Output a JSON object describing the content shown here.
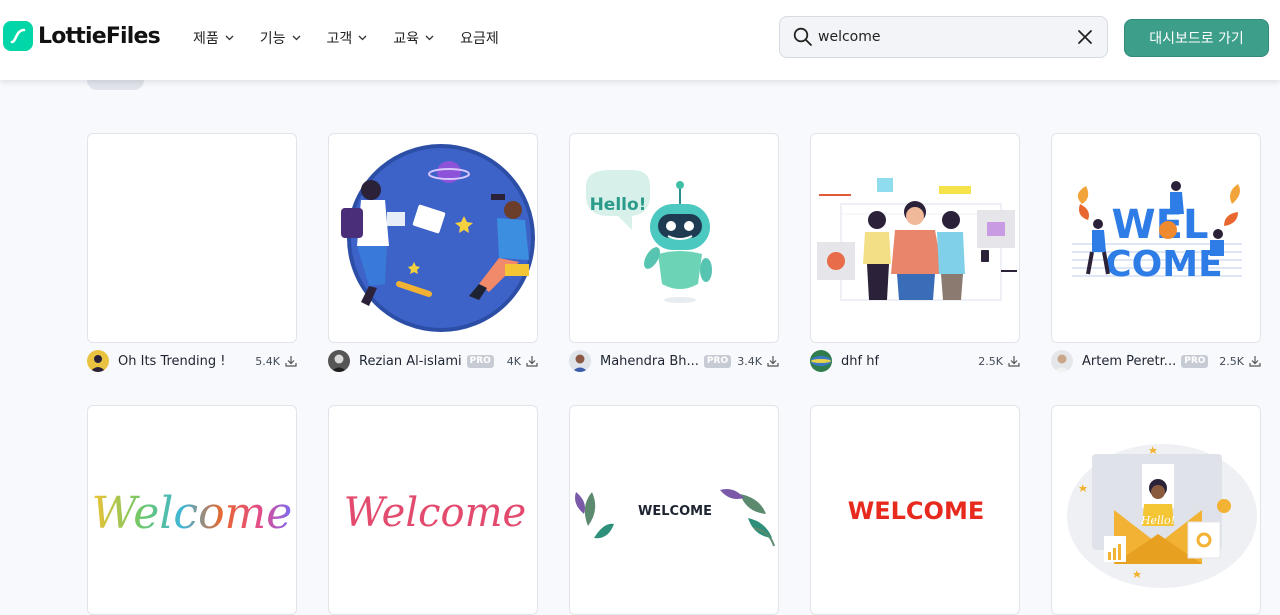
{
  "brand": {
    "name": "LottieFiles"
  },
  "nav": [
    "제품",
    "기능",
    "고객",
    "교육",
    "요금제"
  ],
  "search": {
    "value": "welcome"
  },
  "cta": {
    "label": "대시보드로 가기"
  },
  "cards": [
    {
      "author": "Oh Its Trending !",
      "pro": "",
      "downloads": "5.4K"
    },
    {
      "author": "Rezian Al-islami",
      "pro": "PRO",
      "downloads": "4K"
    },
    {
      "author": "Mahendra Bh...",
      "pro": "PRO",
      "downloads": "3.4K"
    },
    {
      "author": "dhf hf",
      "pro": "",
      "downloads": "2.5K"
    },
    {
      "author": "Artem Peretr...",
      "pro": "PRO",
      "downloads": "2.5K"
    }
  ],
  "artwork_text": {
    "hello_bubble": "Hello!",
    "wel": "WEL",
    "come": "COME",
    "welcome_rainbow": "Welcome",
    "welcome_script": "Welcome",
    "welcome_caps": "WELCOME",
    "welcome_red": "WELCOME",
    "hello_envelope": "Hello!"
  },
  "colors": {
    "accent": "#3d9e8a",
    "logo": "#00d6a8",
    "red_welcome": "#e8291d",
    "script_pink": "#e24b6e",
    "blue_welcome": "#2e7ce6"
  }
}
